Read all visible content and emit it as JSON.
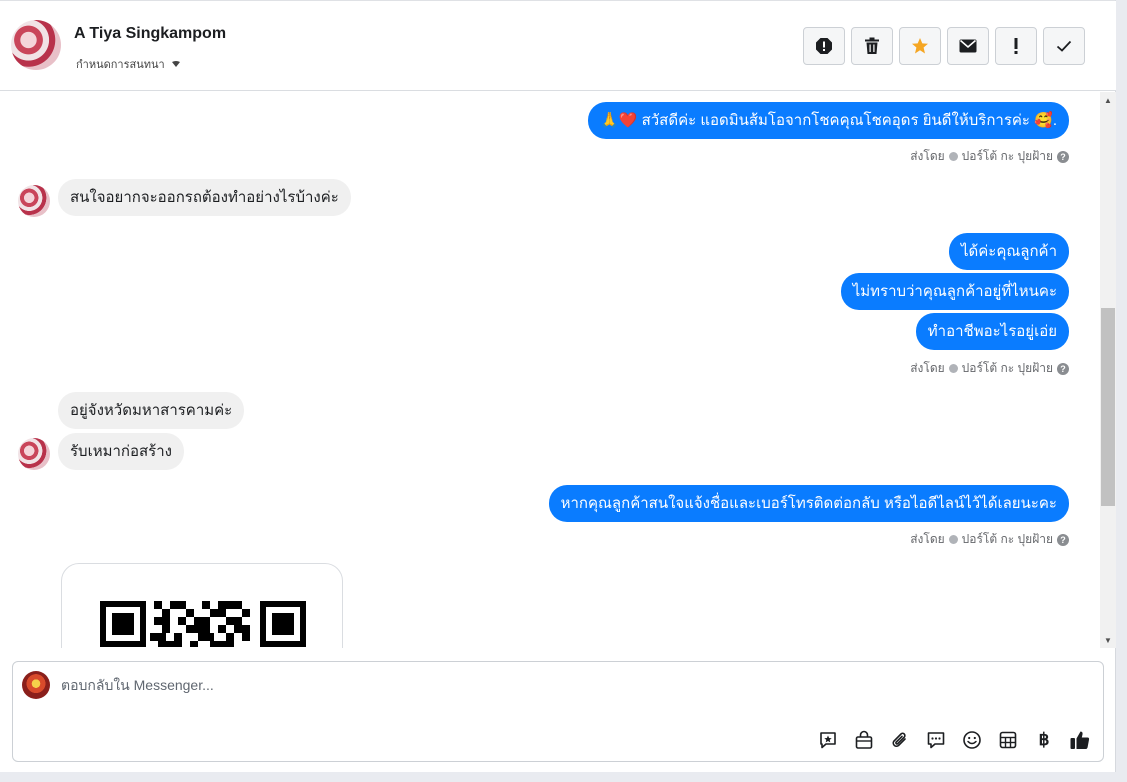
{
  "header": {
    "contact_name": "A Tiya Singkampom",
    "assign_label": "กำหนดการสนทนา",
    "toolbar_icons": [
      "alert-icon",
      "trash-icon",
      "star-icon",
      "envelope-icon",
      "exclamation-icon",
      "check-icon"
    ]
  },
  "colors": {
    "outgoing": "#0a7cff",
    "incoming": "#f0f0f0",
    "star": "#f5a623"
  },
  "messages": {
    "m1": "🙏❤️ สวัสดีค่ะ แอดมินส้มโอจากโชคคุณโชคอุดร ยินดีให้บริการค่ะ 🥰.",
    "m2": "สนใจอยากจะออกรถต้องทำอย่างไรบ้างค่ะ",
    "m3": "ได้ค่ะคุณลูกค้า",
    "m4": "ไม่ทราบว่าคุณลูกค้าอยู่ที่ไหนคะ",
    "m5": "ทำอาชีพอะไรอยู่เอ่ย",
    "m6": "อยู่จังหวัดมหาสารคามค่ะ",
    "m7": "รับเหมาก่อสร้าง",
    "m8": "หากคุณลูกค้าสนใจแจ้งชื่อและเบอร์โทรติดต่อกลับ หรือไอดีไลน์ไว้ได้เลยนะคะ"
  },
  "sent_by": {
    "prefix": "ส่งโดย",
    "agent": "ปอร์โต้ กะ ปุยฝ้าย",
    "help": "?"
  },
  "composer": {
    "placeholder": "ตอบกลับใน Messenger...",
    "tool_icons": [
      "saved-reply-icon",
      "shop-icon",
      "attachment-icon",
      "chat-icon",
      "emoji-icon",
      "table-icon",
      "baht-icon",
      "like-icon"
    ],
    "baht_symbol": "฿"
  },
  "scrollbar": {
    "up": "▲",
    "down": "▼"
  }
}
